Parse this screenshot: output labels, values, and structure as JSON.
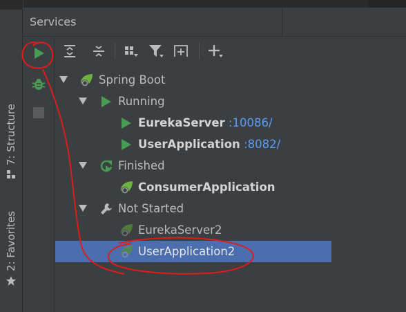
{
  "left_strip": {
    "tabs": [
      {
        "label": "7: Structure",
        "icon": "structure-icon"
      },
      {
        "label": "2: Favorites",
        "icon": "star-icon"
      }
    ]
  },
  "panel": {
    "title": "Services",
    "actions": [
      {
        "name": "run",
        "icon": "run-icon"
      },
      {
        "name": "debug",
        "icon": "debug-icon"
      },
      {
        "name": "stop",
        "icon": "stop-icon"
      }
    ],
    "toolbar": [
      "expand-all-icon",
      "collapse-all-icon",
      "group-by-icon",
      "filter-icon",
      "new-tab-icon",
      "add-service-icon"
    ]
  },
  "tree": {
    "root": {
      "label": "Spring Boot"
    },
    "running": {
      "label": "Running",
      "items": [
        {
          "name": "EurekaServer",
          "port": ":10086/"
        },
        {
          "name": "UserApplication",
          "port": ":8082/"
        }
      ]
    },
    "finished": {
      "label": "Finished",
      "items": [
        {
          "name": "ConsumerApplication"
        }
      ]
    },
    "not_started": {
      "label": "Not Started",
      "items": [
        {
          "name": "EurekaServer2"
        },
        {
          "name": "UserApplication2"
        }
      ]
    }
  },
  "colors": {
    "background": "#3c3f41",
    "selection": "#4b6eaf",
    "run_green": "#499c54",
    "port_blue": "#589df6",
    "annotation_red": "#e01b1b"
  }
}
